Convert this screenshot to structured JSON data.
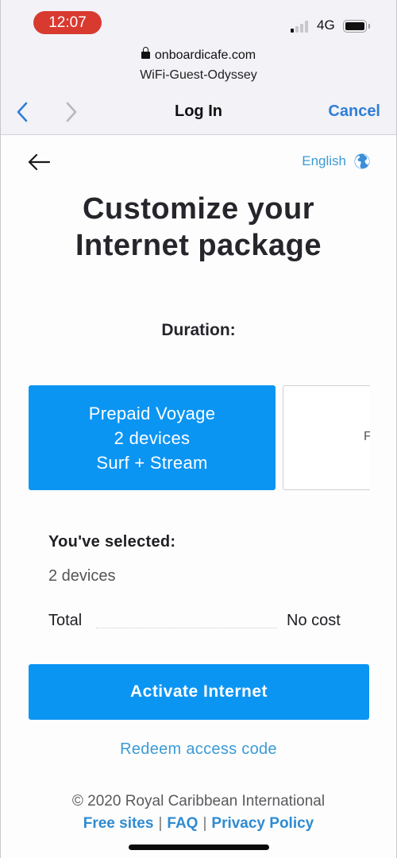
{
  "status_bar": {
    "time": "12:07",
    "network": "4G",
    "signal_bars_active": 1,
    "signal_bars_total": 4,
    "battery_level": "full"
  },
  "browser": {
    "domain": "onboardicafe.com",
    "network_name": "WiFi-Guest-Odyssey",
    "title": "Log In",
    "cancel_label": "Cancel",
    "icons": {
      "back": "chevron-left-icon",
      "forward": "chevron-right-icon",
      "lock": "lock-icon"
    }
  },
  "page": {
    "language": "English",
    "headline_line1": "Customize your",
    "headline_line2": "Internet package",
    "duration_label": "Duration:",
    "packages": [
      {
        "line1": "Prepaid Voyage",
        "line2": "2 devices",
        "line3": "Surf + Stream",
        "selected": true
      },
      {
        "visible_text": "F",
        "selected": false
      }
    ],
    "summary": {
      "title": "You've selected:",
      "devices": "2 devices",
      "total_label": "Total",
      "total_value": "No cost"
    },
    "activate_label": "Activate Internet",
    "redeem_label": "Redeem access code"
  },
  "footer": {
    "copyright": "© 2020 Royal Caribbean International",
    "links": [
      "Free sites",
      "FAQ",
      "Privacy Policy"
    ],
    "separator": "|"
  },
  "colors": {
    "primary": "#0b95f3",
    "link": "#3b9bd6",
    "recording_pill": "#d93a30",
    "ios_blue": "#2f7ed8"
  }
}
